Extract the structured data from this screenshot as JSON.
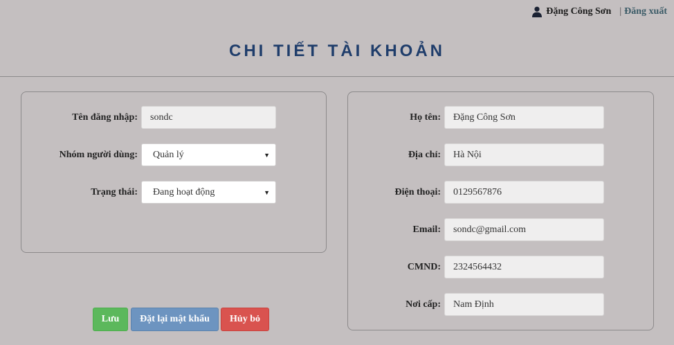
{
  "header": {
    "user_name": "Đặng Công Sơn",
    "separator": "|",
    "logout_label": "Đăng xuất",
    "page_title": "CHI TIẾT TÀI KHOẢN"
  },
  "account": {
    "username_label": "Tên đăng nhập:",
    "username_value": "sondc",
    "group_label": "Nhóm người dùng:",
    "group_value": "Quản lý",
    "status_label": "Trạng thái:",
    "status_value": "Đang hoạt động"
  },
  "profile": {
    "fullname_label": "Họ tên:",
    "fullname_value": "Đặng Công Sơn",
    "address_label": "Địa chỉ:",
    "address_value": "Hà Nội",
    "phone_label": "Điện thoại:",
    "phone_value": "0129567876",
    "email_label": "Email:",
    "email_value": "sondc@gmail.com",
    "idcard_label": "CMND:",
    "idcard_value": "2324564432",
    "issued_label": "Nơi cấp:",
    "issued_value": "Nam Định"
  },
  "actions": {
    "save_label": "Lưu",
    "reset_password_label": "Đặt lại mật khẩu",
    "cancel_label": "Hủy bỏ"
  },
  "icons": {
    "user": "user-icon",
    "dropdown": "chevron-down-icon"
  },
  "colors": {
    "background": "#c4bfc0",
    "title": "#1f3d6b",
    "save": "#5cb85c",
    "reset": "#6d94c0",
    "cancel": "#d9534f"
  }
}
